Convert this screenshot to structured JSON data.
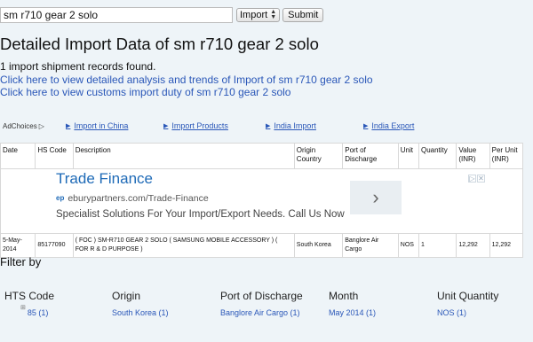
{
  "search": {
    "value": "sm r710 gear 2 solo",
    "type_selected": "Import",
    "submit_label": "Submit"
  },
  "page_title": "Detailed Import Data of sm r710 gear 2 solo",
  "records_text": "1 import shipment records found.",
  "links": {
    "analysis": "Click here to view detailed analysis and trends of Import of sm r710 gear 2 solo",
    "duty": "Click here to view customs import duty of sm r710 gear 2 solo"
  },
  "adbar": {
    "adchoices": "AdChoices",
    "links": [
      "Import in China",
      "Import Products",
      "India Import",
      "India Export"
    ]
  },
  "table": {
    "headers": [
      "Date",
      "HS Code",
      "Description",
      "Origin Country",
      "Port of Discharge",
      "Unit",
      "Quantity",
      "Value (INR)",
      "Per Unit (INR)"
    ],
    "rows": [
      {
        "date": "5-May-2014",
        "hs_code": "85177090",
        "description": "( FOC ) SM-R710 GEAR 2 SOLO ( SAMSUNG MOBILE ACCESSORY ) ( FOR R & D PURPOSE )",
        "origin": "South Korea",
        "port": "Banglore Air Cargo",
        "unit": "NOS",
        "quantity": "1",
        "value": "12,292",
        "per_unit": "12,292"
      }
    ]
  },
  "ad": {
    "title": "Trade Finance",
    "url": "eburypartners.com/Trade-Finance",
    "url_prefix": "ep",
    "description": "Specialist Solutions For Your Import/Export Needs. Call Us Now",
    "next_icon": "chevron-right-icon"
  },
  "filters": {
    "title": "Filter by",
    "columns": [
      {
        "heading": "HTS Code",
        "option": "85 (1)"
      },
      {
        "heading": "Origin",
        "option": "South Korea (1)"
      },
      {
        "heading": "Port of Discharge",
        "option": "Banglore Air Cargo (1)"
      },
      {
        "heading": "Month",
        "option": "May 2014 (1)"
      },
      {
        "heading": "Unit Quantity",
        "option": "NOS (1)"
      }
    ]
  },
  "colors": {
    "link": "#2a57b8",
    "ad_title": "#1e6ab7",
    "background": "#eef4f8"
  }
}
